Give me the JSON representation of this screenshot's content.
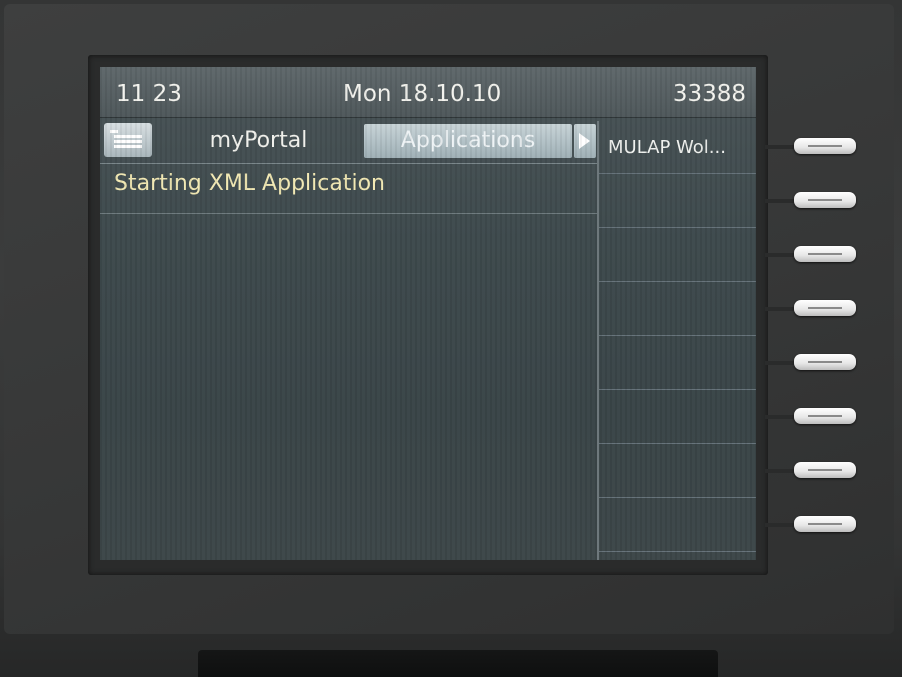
{
  "status_bar": {
    "time": "11 23",
    "date": "Mon 18.10.10",
    "extension": "33388"
  },
  "tabs": {
    "menu_icon": "menu-icon",
    "portal_label": "myPortal",
    "applications_label": "Applications",
    "more_icon": "arrow-right-icon"
  },
  "message": "Starting XML Application",
  "function_keys": [
    {
      "label": "MULAP Wol..."
    },
    {
      "label": ""
    },
    {
      "label": ""
    },
    {
      "label": ""
    },
    {
      "label": ""
    },
    {
      "label": ""
    },
    {
      "label": ""
    },
    {
      "label": ""
    }
  ],
  "colors": {
    "screen_bg": "#3e4a4d",
    "message_text": "#f2e9b4",
    "selected_tab": "#b4c3c8"
  }
}
